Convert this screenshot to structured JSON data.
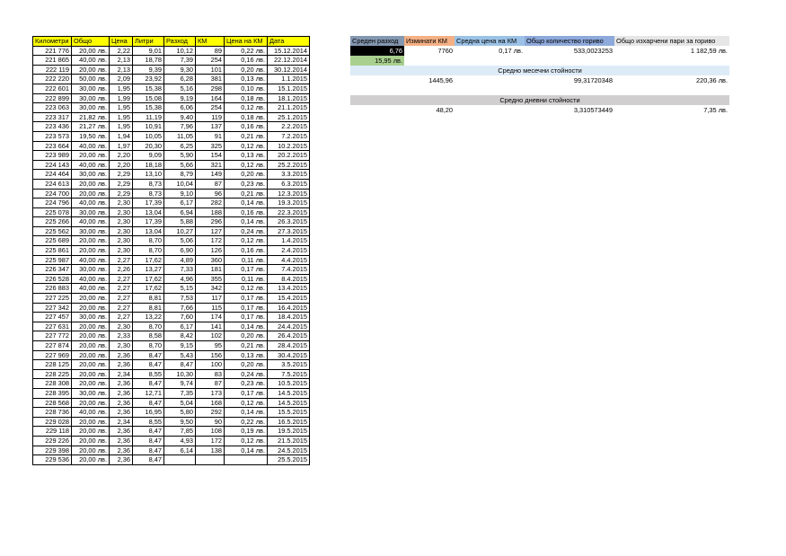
{
  "log": {
    "headers": [
      "Километри",
      "Общо",
      "Цена",
      "Литри",
      "Разход",
      "КМ",
      "Цена на КМ",
      "Дата"
    ],
    "rows": [
      [
        "221 776",
        "20,00 лв.",
        "2,22",
        "9,01",
        "10,12",
        "89",
        "0,22 лв.",
        "15.12.2014"
      ],
      [
        "221 865",
        "40,00 лв.",
        "2,13",
        "18,78",
        "7,39",
        "254",
        "0,16 лв.",
        "22.12.2014"
      ],
      [
        "222 119",
        "20,00 лв.",
        "2,13",
        "9,39",
        "9,30",
        "101",
        "0,20 лв.",
        "30.12.2014"
      ],
      [
        "222 220",
        "50,00 лв.",
        "2,09",
        "23,92",
        "6,28",
        "381",
        "0,13 лв.",
        "1.1.2015"
      ],
      [
        "222 601",
        "30,00 лв.",
        "1,95",
        "15,38",
        "5,16",
        "298",
        "0,10 лв.",
        "15.1.2015"
      ],
      [
        "222 899",
        "30,00 лв.",
        "1,99",
        "15,08",
        "9,19",
        "164",
        "0,18 лв.",
        "18.1.2015"
      ],
      [
        "223 063",
        "30,00 лв.",
        "1,95",
        "15,38",
        "6,06",
        "254",
        "0,12 лв.",
        "21.1.2015"
      ],
      [
        "223 317",
        "21,82 лв.",
        "1,95",
        "11,19",
        "9,40",
        "119",
        "0,18 лв.",
        "25.1.2015"
      ],
      [
        "223 436",
        "21,27 лв.",
        "1,95",
        "10,91",
        "7,96",
        "137",
        "0,16 лв.",
        "2.2.2015"
      ],
      [
        "223 573",
        "19,50 лв.",
        "1,94",
        "10,05",
        "11,05",
        "91",
        "0,21 лв.",
        "7.2.2015"
      ],
      [
        "223 664",
        "40,00 лв.",
        "1,97",
        "20,30",
        "6,25",
        "325",
        "0,12 лв.",
        "10.2.2015"
      ],
      [
        "223 989",
        "20,00 лв.",
        "2,20",
        "9,09",
        "5,90",
        "154",
        "0,13 лв.",
        "20.2.2015"
      ],
      [
        "224 143",
        "40,00 лв.",
        "2,20",
        "18,18",
        "5,66",
        "321",
        "0,12 лв.",
        "25.2.2015"
      ],
      [
        "224 464",
        "30,00 лв.",
        "2,29",
        "13,10",
        "8,79",
        "149",
        "0,20 лв.",
        "3.3.2015"
      ],
      [
        "224 613",
        "20,00 лв.",
        "2,29",
        "8,73",
        "10,04",
        "87",
        "0,23 лв.",
        "6.3.2015"
      ],
      [
        "224 700",
        "20,00 лв.",
        "2,29",
        "8,73",
        "9,10",
        "96",
        "0,21 лв.",
        "12.3.2015"
      ],
      [
        "224 796",
        "40,00 лв.",
        "2,30",
        "17,39",
        "6,17",
        "282",
        "0,14 лв.",
        "19.3.2015"
      ],
      [
        "225 078",
        "30,00 лв.",
        "2,30",
        "13,04",
        "6,94",
        "188",
        "0,16 лв.",
        "22.3.2015"
      ],
      [
        "225 266",
        "40,00 лв.",
        "2,30",
        "17,39",
        "5,88",
        "296",
        "0,14 лв.",
        "26.3.2015"
      ],
      [
        "225 562",
        "30,00 лв.",
        "2,30",
        "13,04",
        "10,27",
        "127",
        "0,24 лв.",
        "27.3.2015"
      ],
      [
        "225 689",
        "20,00 лв.",
        "2,30",
        "8,70",
        "5,06",
        "172",
        "0,12 лв.",
        "1.4.2015"
      ],
      [
        "225 861",
        "20,00 лв.",
        "2,30",
        "8,70",
        "6,90",
        "126",
        "0,16 лв.",
        "2.4.2015"
      ],
      [
        "225 987",
        "40,00 лв.",
        "2,27",
        "17,62",
        "4,89",
        "360",
        "0,11 лв.",
        "4.4.2015"
      ],
      [
        "226 347",
        "30,00 лв.",
        "2,26",
        "13,27",
        "7,33",
        "181",
        "0,17 лв.",
        "7.4.2015"
      ],
      [
        "226 528",
        "40,00 лв.",
        "2,27",
        "17,62",
        "4,96",
        "355",
        "0,11 лв.",
        "8.4.2015"
      ],
      [
        "226 883",
        "40,00 лв.",
        "2,27",
        "17,62",
        "5,15",
        "342",
        "0,12 лв.",
        "13.4.2015"
      ],
      [
        "227 225",
        "20,00 лв.",
        "2,27",
        "8,81",
        "7,53",
        "117",
        "0,17 лв.",
        "15.4.2015"
      ],
      [
        "227 342",
        "20,00 лв.",
        "2,27",
        "8,81",
        "7,66",
        "115",
        "0,17 лв.",
        "16.4.2015"
      ],
      [
        "227 457",
        "30,00 лв.",
        "2,27",
        "13,22",
        "7,60",
        "174",
        "0,17 лв.",
        "18.4.2015"
      ],
      [
        "227 631",
        "20,00 лв.",
        "2,30",
        "8,70",
        "6,17",
        "141",
        "0,14 лв.",
        "24.4.2015"
      ],
      [
        "227 772",
        "20,00 лв.",
        "2,33",
        "8,58",
        "8,42",
        "102",
        "0,20 лв.",
        "26.4.2015"
      ],
      [
        "227 874",
        "20,00 лв.",
        "2,30",
        "8,70",
        "9,15",
        "95",
        "0,21 лв.",
        "28.4.2015"
      ],
      [
        "227 969",
        "20,00 лв.",
        "2,36",
        "8,47",
        "5,43",
        "156",
        "0,13 лв.",
        "30.4.2015"
      ],
      [
        "228 125",
        "20,00 лв.",
        "2,36",
        "8,47",
        "8,47",
        "100",
        "0,20 лв.",
        "3.5.2015"
      ],
      [
        "228 225",
        "20,00 лв.",
        "2,34",
        "8,55",
        "10,30",
        "83",
        "0,24 лв.",
        "7.5.2015"
      ],
      [
        "228 308",
        "20,00 лв.",
        "2,36",
        "8,47",
        "9,74",
        "87",
        "0,23 лв.",
        "10.5.2015"
      ],
      [
        "228 395",
        "30,00 лв.",
        "2,36",
        "12,71",
        "7,35",
        "173",
        "0,17 лв.",
        "14.5.2015"
      ],
      [
        "228 568",
        "20,00 лв.",
        "2,36",
        "8,47",
        "5,04",
        "168",
        "0,12 лв.",
        "14.5.2015"
      ],
      [
        "228 736",
        "40,00 лв.",
        "2,36",
        "16,95",
        "5,80",
        "292",
        "0,14 лв.",
        "15.5.2015"
      ],
      [
        "229 028",
        "20,00 лв.",
        "2,34",
        "8,55",
        "9,50",
        "90",
        "0,22 лв.",
        "16.5.2015"
      ],
      [
        "229 118",
        "20,00 лв.",
        "2,36",
        "8,47",
        "7,85",
        "108",
        "0,19 лв.",
        "19.5.2015"
      ],
      [
        "229 226",
        "20,00 лв.",
        "2,36",
        "8,47",
        "4,93",
        "172",
        "0,12 лв.",
        "21.5.2015"
      ],
      [
        "229 398",
        "20,00 лв.",
        "2,36",
        "8,47",
        "6,14",
        "138",
        "0,14 лв.",
        "24.5.2015"
      ],
      [
        "229 536",
        "20,00 лв.",
        "2,36",
        "8,47",
        "",
        "",
        "",
        "25.5.2015"
      ]
    ]
  },
  "summary": {
    "headers": [
      "Среден разход",
      "Изминати КМ",
      "Средна цена на КМ",
      "Общо количество гориво",
      "Общо изхарчени пари за гориво"
    ],
    "totals": [
      "6,76",
      "7760",
      "0,17 лв.",
      "533,0023253",
      "1 182,59 лв."
    ],
    "extra_value": "15,95 лв.",
    "monthly_title": "Средно месечни стойности",
    "monthly": [
      "1445,96",
      "99,31720348",
      "220,36 лв."
    ],
    "daily_title": "Средно дневни стойности",
    "daily": [
      "48,20",
      "3,310573449",
      "7,35 лв."
    ]
  },
  "colors": {
    "log_header": "#ffff00",
    "h_avg": "#8497b0",
    "h_km": "#f4b084",
    "h_price": "#9bc2e6",
    "h_fuel": "#8ea9db",
    "h_money": "#e7e6e6",
    "avg_cell": "#000000",
    "extra_cell": "#a9d08e",
    "monthly_band": "#ddebf7",
    "daily_band": "#d0cece"
  }
}
